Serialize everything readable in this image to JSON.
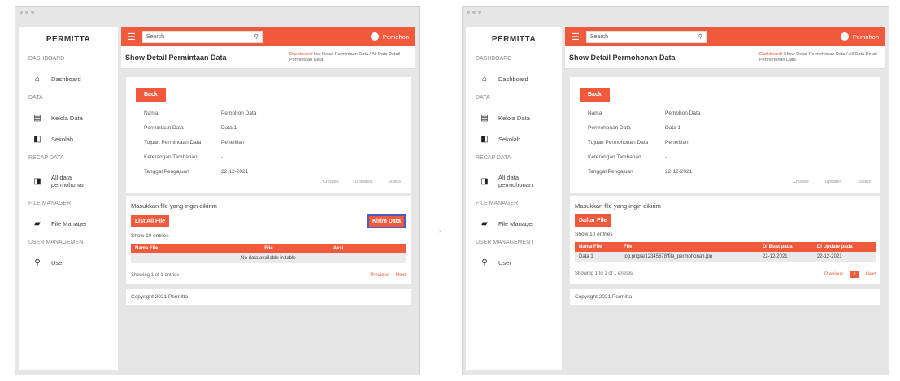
{
  "screens": [
    {
      "brand": "PERMITTA",
      "sidebar": {
        "dashboard_section": "DASHBOARD",
        "dashboard": "Dashboard",
        "data_section": "DATA",
        "kelola_data": "Kelola Data",
        "sekolah": "Sekolah",
        "recap_section": "RECAP DATA",
        "all_data": "All data permohonan",
        "file_section": "FILE MANAGER",
        "file_manager": "File Manager",
        "user_section": "USER MANAGEMENT",
        "user": "User"
      },
      "topbar": {
        "search": "Search",
        "user": "Pemohon"
      },
      "page_title": "Show Detail Permintaan Data",
      "breadcrumb": {
        "home": "Dashboard",
        "rest": "/ List Detail Permintaan Data / All Data Detail Permintaan Data"
      },
      "back": "Back",
      "fields": [
        {
          "label": "Nama",
          "value": "Pemohon Data"
        },
        {
          "label": "Permintaan Data",
          "value": "Data 1"
        },
        {
          "label": "Tujuan Permintaan Data",
          "value": "Penelitian"
        },
        {
          "label": "Keterangan Tambahan",
          "value": "-"
        },
        {
          "label": "Tanggal Pengajuan",
          "value": "22-12-2021"
        }
      ],
      "meta": [
        "Created",
        "Updated",
        "Status"
      ],
      "upload_label": "Masukkan file yang ingin dikirim",
      "list_btn": "List All File",
      "upload_btn": "Kirim Data",
      "show_entries": "Show 10 entries",
      "columns": [
        "Nama File",
        "File",
        "Aksi"
      ],
      "empty_row": "No data available in table",
      "showing": "Showing 1 of 1 entries",
      "prev": "Previous",
      "next": "Next",
      "footer": "Copyright 2021 Permitta"
    },
    {
      "brand": "PERMITTA",
      "sidebar": {
        "dashboard_section": "DASHBOARD",
        "dashboard": "Dashboard",
        "data_section": "DATA",
        "kelola_data": "Kelola Data",
        "sekolah": "Sekolah",
        "recap_section": "RECAP DATA",
        "all_data": "All data permohonan",
        "file_section": "FILE MANAGER",
        "file_manager": "File Manager",
        "user_section": "USER MANAGEMENT",
        "user": "User"
      },
      "topbar": {
        "search": "Search",
        "user": "Pemohon"
      },
      "page_title": "Show Detail Permohonan Data",
      "breadcrumb": {
        "home": "Dashboard",
        "rest": "/ Show Detail Permohonan Data / All Data Detail Permohonan Data"
      },
      "back": "Back",
      "fields": [
        {
          "label": "Nama",
          "value": "Pemohon Data"
        },
        {
          "label": "Permohonan Data",
          "value": "Data 1"
        },
        {
          "label": "Tujuan Permohonan Data",
          "value": "Penelitian"
        },
        {
          "label": "Keterangan Tambahan",
          "value": "-"
        },
        {
          "label": "Tanggal Pengajuan",
          "value": "22-12-2021"
        }
      ],
      "meta": [
        "Created",
        "Updated",
        "Status"
      ],
      "upload_label": "Masukkan file yang ingin dikirim",
      "list_btn": "Daftar File",
      "show_entries": "Show 10 entries",
      "columns": [
        "Nama File",
        "File",
        "Di Buat pada",
        "Di Update pada"
      ],
      "rows": [
        [
          "Data 1",
          "jpg.png/a/12345678/file_permohonan.jpg",
          "22-12-2021",
          "22-12-2021"
        ]
      ],
      "showing": "Showing 1 to 1 of 1 entries",
      "prev": "Previous",
      "page": "1",
      "next": "Next",
      "footer": "Copyright 2021 Permitta"
    }
  ]
}
